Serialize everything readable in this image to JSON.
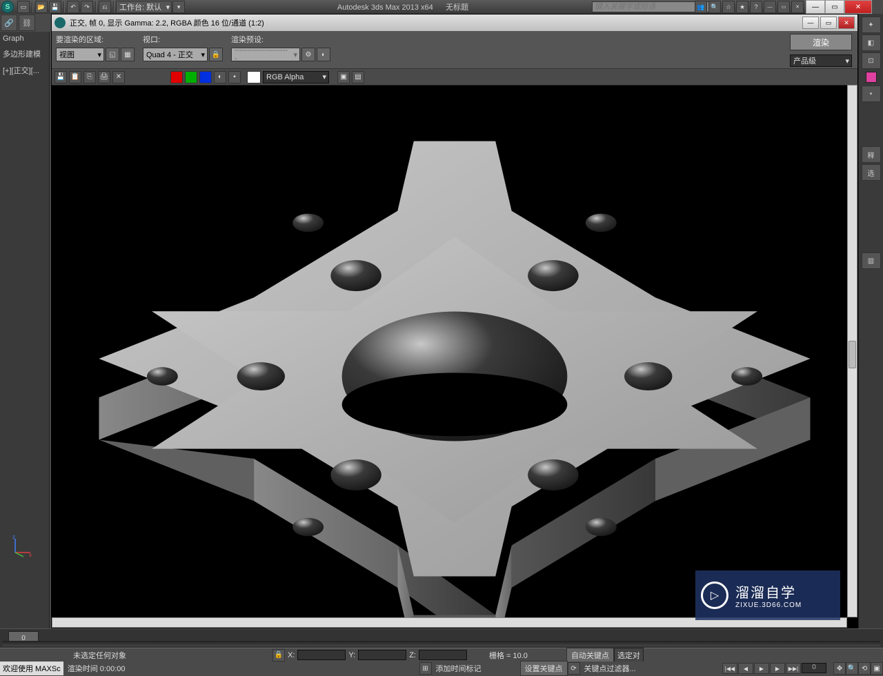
{
  "app": {
    "title": "Autodesk 3ds Max  2013 x64",
    "document": "无标题",
    "search_placeholder": "键入关键字或短语",
    "workspace_label": "工作台: 默认"
  },
  "left_panel": {
    "tab": "Graph",
    "modifier": "多边形建模",
    "viewport_label": "[+][正交][..."
  },
  "render_window": {
    "title": "正交, 帧 0, 显示 Gamma: 2.2, RGBA 颜色 16 位/通道 (1:2)",
    "area_label": "要渲染的区域:",
    "area_value": "视图",
    "viewport_label": "视口:",
    "viewport_value": "Quad 4 - 正交",
    "preset_label": "渲染预设:",
    "preset_value": "----------------------",
    "render_button": "渲染",
    "production": "产品級",
    "channel": "RGB Alpha"
  },
  "status": {
    "selection": "未选定任何对象",
    "x": "X:",
    "y": "Y:",
    "z": "Z:",
    "grid": "栅格 = 10.0",
    "autokey": "自动关键点",
    "selected": "选定对"
  },
  "bottom": {
    "welcome": "欢迎使用 MAXSc",
    "render_time": "渲染时间 0:00:00",
    "add_marker": "添加时间标记",
    "set_key": "设置关键点",
    "key_filter": "关键点过滤器...",
    "frame": "0"
  },
  "timeline": {
    "frame": "0"
  },
  "watermark": {
    "brand": "溜溜自学",
    "url": "ZIXUE.3D66.COM"
  }
}
